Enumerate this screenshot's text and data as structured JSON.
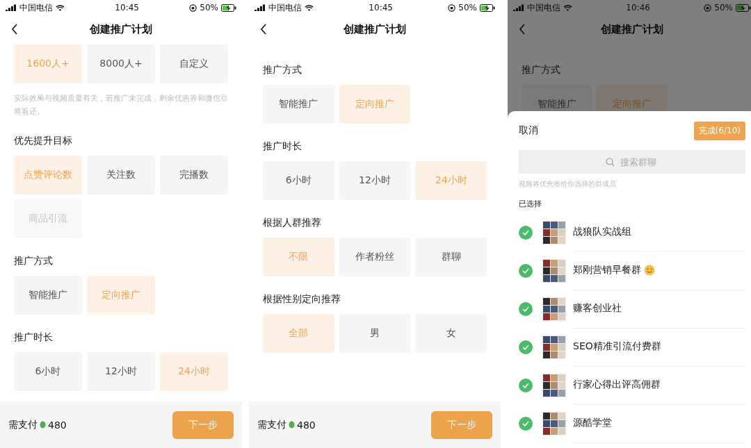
{
  "screens": [
    {
      "status_bar": {
        "carrier": "中国电信",
        "time": "10:45",
        "battery": "50%"
      },
      "title": "创建推广计划",
      "dimmed": false,
      "sections": [
        {
          "options": [
            {
              "label": "1600人+",
              "selected": true,
              "disabled": false
            },
            {
              "label": "8000人+",
              "selected": false,
              "disabled": false
            },
            {
              "label": "自定义",
              "selected": false,
              "disabled": false
            }
          ],
          "note": "实际效果与视频质量有关，若推广未完成，剩余优惠券和微信豆将返还。"
        },
        {
          "heading": "优先提升目标",
          "options": [
            {
              "label": "点赞评论数",
              "selected": true,
              "disabled": false
            },
            {
              "label": "关注数",
              "selected": false,
              "disabled": false
            },
            {
              "label": "完播数",
              "selected": false,
              "disabled": false
            },
            {
              "label": "商品引流",
              "selected": false,
              "disabled": true
            }
          ]
        },
        {
          "heading": "推广方式",
          "options": [
            {
              "label": "智能推广",
              "selected": false,
              "disabled": false
            },
            {
              "label": "定向推广",
              "selected": true,
              "disabled": false
            }
          ]
        },
        {
          "heading": "推广时长",
          "options": [
            {
              "label": "6小时",
              "selected": false,
              "disabled": false
            },
            {
              "label": "12小时",
              "selected": false,
              "disabled": false
            },
            {
              "label": "24小时",
              "selected": true,
              "disabled": false
            }
          ]
        }
      ],
      "footer": {
        "label": "需支付",
        "amount": "480",
        "button": "下一步"
      }
    },
    {
      "status_bar": {
        "carrier": "中国电信",
        "time": "10:45",
        "battery": "50%"
      },
      "title": "创建推广计划",
      "dimmed": false,
      "sections": [
        {
          "heading": "推广方式",
          "options": [
            {
              "label": "智能推广",
              "selected": false,
              "disabled": false
            },
            {
              "label": "定向推广",
              "selected": true,
              "disabled": false
            }
          ]
        },
        {
          "heading": "推广时长",
          "options": [
            {
              "label": "6小时",
              "selected": false,
              "disabled": false
            },
            {
              "label": "12小时",
              "selected": false,
              "disabled": false
            },
            {
              "label": "24小时",
              "selected": true,
              "disabled": false
            }
          ]
        },
        {
          "heading": "根据人群推荐",
          "options": [
            {
              "label": "不限",
              "selected": true,
              "disabled": false
            },
            {
              "label": "作者粉丝",
              "selected": false,
              "disabled": false
            },
            {
              "label": "群聊",
              "selected": false,
              "disabled": false
            }
          ]
        },
        {
          "heading": "根据性别定向推荐",
          "options": [
            {
              "label": "全部",
              "selected": true,
              "disabled": false
            },
            {
              "label": "男",
              "selected": false,
              "disabled": false
            },
            {
              "label": "女",
              "selected": false,
              "disabled": false
            }
          ]
        }
      ],
      "footer": {
        "label": "需支付",
        "amount": "480",
        "button": "下一步"
      }
    },
    {
      "status_bar": {
        "carrier": "中国电信",
        "time": "10:46",
        "battery": "50%"
      },
      "title": "创建推广计划",
      "dimmed": true,
      "sections": [
        {
          "heading": "推广方式",
          "options": [
            {
              "label": "智能推广",
              "selected": false,
              "disabled": false
            },
            {
              "label": "定向推广",
              "selected": true,
              "disabled": false
            }
          ]
        }
      ],
      "sheet": {
        "cancel": "取消",
        "done": "完成(6/10)",
        "search": {
          "placeholder": "搜索群聊"
        },
        "hint": "视频将优先推给你选择的群成员",
        "selected_heading": "已选择",
        "groups": [
          {
            "name": "战狼队实战组",
            "checked": true,
            "emoji": false
          },
          {
            "name": "郑刚营销早餐群",
            "checked": true,
            "emoji": true
          },
          {
            "name": "赚客创业社",
            "checked": true,
            "emoji": false
          },
          {
            "name": "SEO精准引流付费群",
            "checked": true,
            "emoji": false
          },
          {
            "name": "行家心得出评高佣群",
            "checked": true,
            "emoji": false
          },
          {
            "name": "源酷学堂",
            "checked": true,
            "emoji": false
          }
        ]
      }
    }
  ]
}
